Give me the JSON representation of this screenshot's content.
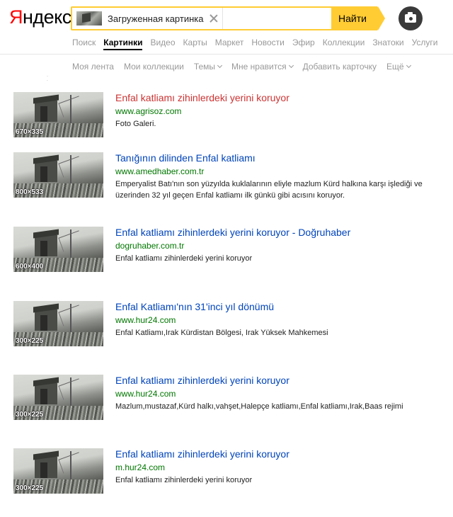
{
  "header": {
    "logo_first": "Я",
    "logo_rest": "ндекс",
    "search_chip_label": "Загруженная картинка",
    "find_button": "Найти",
    "camera_icon": "camera-icon"
  },
  "services": [
    {
      "label": "Поиск",
      "active": false
    },
    {
      "label": "Картинки",
      "active": true
    },
    {
      "label": "Видео",
      "active": false
    },
    {
      "label": "Карты",
      "active": false
    },
    {
      "label": "Маркет",
      "active": false
    },
    {
      "label": "Новости",
      "active": false
    },
    {
      "label": "Эфир",
      "active": false
    },
    {
      "label": "Коллекции",
      "active": false
    },
    {
      "label": "Знатоки",
      "active": false
    },
    {
      "label": "Услуги",
      "active": false
    }
  ],
  "subnav": [
    {
      "label": "Моя лента",
      "dropdown": false
    },
    {
      "label": "Мои коллекции",
      "dropdown": false
    },
    {
      "label": "Темы",
      "dropdown": true
    },
    {
      "label": "Мне нравится",
      "dropdown": true
    },
    {
      "label": "Добавить карточку",
      "dropdown": false
    },
    {
      "label": "Ещё",
      "dropdown": true
    }
  ],
  "results": [
    {
      "size": "670×335",
      "title": "Enfal katliamı zihinlerdeki yerini koruyor",
      "visited": true,
      "url": "www.agrisoz.com",
      "desc": "Foto Galeri."
    },
    {
      "size": "800×533",
      "title": "Tanığının dilinden Enfal katliamı",
      "visited": false,
      "url": "www.amedhaber.com.tr",
      "desc": "Emperyalist Batı'nın son yüzyılda kuklalarının eliyle mazlum Kürd halkına karşı işlediği ve üzerinden 32 yıl geçen Enfal katliamı ilk günkü gibi acısını koruyor."
    },
    {
      "size": "600×400",
      "title": "Enfal katliamı zihinlerdeki yerini koruyor - Doğruhaber",
      "visited": false,
      "url": "dogruhaber.com.tr",
      "desc": "Enfal katliamı zihinlerdeki yerini koruyor"
    },
    {
      "size": "300×225",
      "title": "Enfal Katliamı'nın 31'inci yıl dönümü",
      "visited": false,
      "url": "www.hur24.com",
      "desc": "Enfal Katliamı,Irak Kürdistan Bölgesi, Irak Yüksek Mahkemesi"
    },
    {
      "size": "300×225",
      "title": "Enfal katliamı zihinlerdeki yerini koruyor",
      "visited": false,
      "url": "www.hur24.com",
      "desc": "Mazlum,mustazaf,Kürd halkı,vahşet,Halepçe katliamı,Enfal katliamı,Irak,Baas rejimi"
    },
    {
      "size": "300×225",
      "title": "Enfal katliamı zihinlerdeki yerini koruyor",
      "visited": false,
      "url": "m.hur24.com",
      "desc": "Enfal katliamı zihinlerdeki yerini koruyor"
    }
  ]
}
